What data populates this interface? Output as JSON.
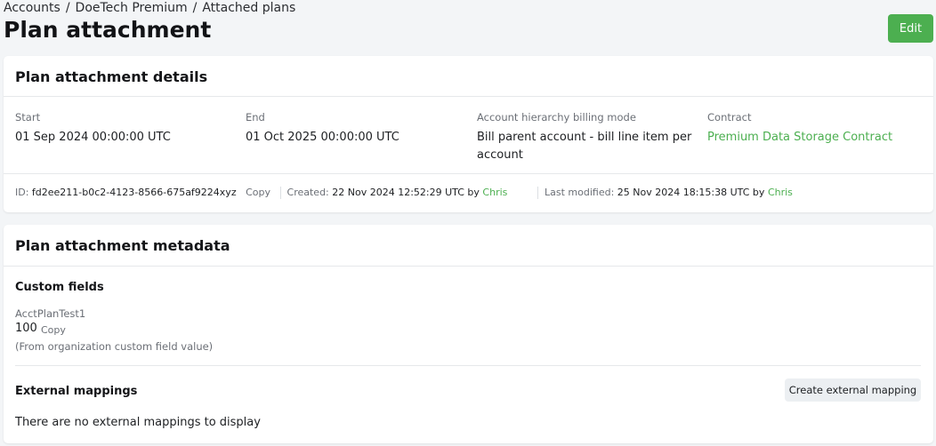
{
  "breadcrumb": {
    "items": [
      "Accounts",
      "DoeTech Premium",
      "Attached plans"
    ],
    "separator": "/"
  },
  "page": {
    "title": "Plan attachment",
    "edit_label": "Edit"
  },
  "details": {
    "title": "Plan attachment details",
    "start": {
      "label": "Start",
      "value": "01 Sep 2024 00:00:00 UTC"
    },
    "end": {
      "label": "End",
      "value": "01 Oct 2025 00:00:00 UTC"
    },
    "billing_mode": {
      "label": "Account hierarchy billing mode",
      "value": "Bill parent account - bill line item per account"
    },
    "contract": {
      "label": "Contract",
      "value": "Premium Data Storage Contract"
    },
    "footer": {
      "id_label": "ID:",
      "id_value": "fd2ee211-b0c2-4123-8566-675af9224xyz",
      "copy_label": "Copy",
      "created_label": "Created:",
      "created_value": "22 Nov 2024 12:52:29 UTC by",
      "created_by": "Chris",
      "modified_label": "Last modified:",
      "modified_value": "25 Nov 2024 18:15:38 UTC by",
      "modified_by": "Chris"
    }
  },
  "metadata": {
    "title": "Plan attachment metadata",
    "custom_fields": {
      "title": "Custom fields",
      "field_name": "AcctPlanTest1",
      "field_value": "100",
      "copy_label": "Copy",
      "note": "(From organization custom field value)"
    },
    "external_mappings": {
      "title": "External mappings",
      "create_label": "Create external mapping",
      "empty_message": "There are no external mappings to display"
    }
  },
  "colors": {
    "accent": "#4caf50",
    "background": "#f3f5f7",
    "card": "#ffffff",
    "muted_text": "#6b6f76"
  }
}
